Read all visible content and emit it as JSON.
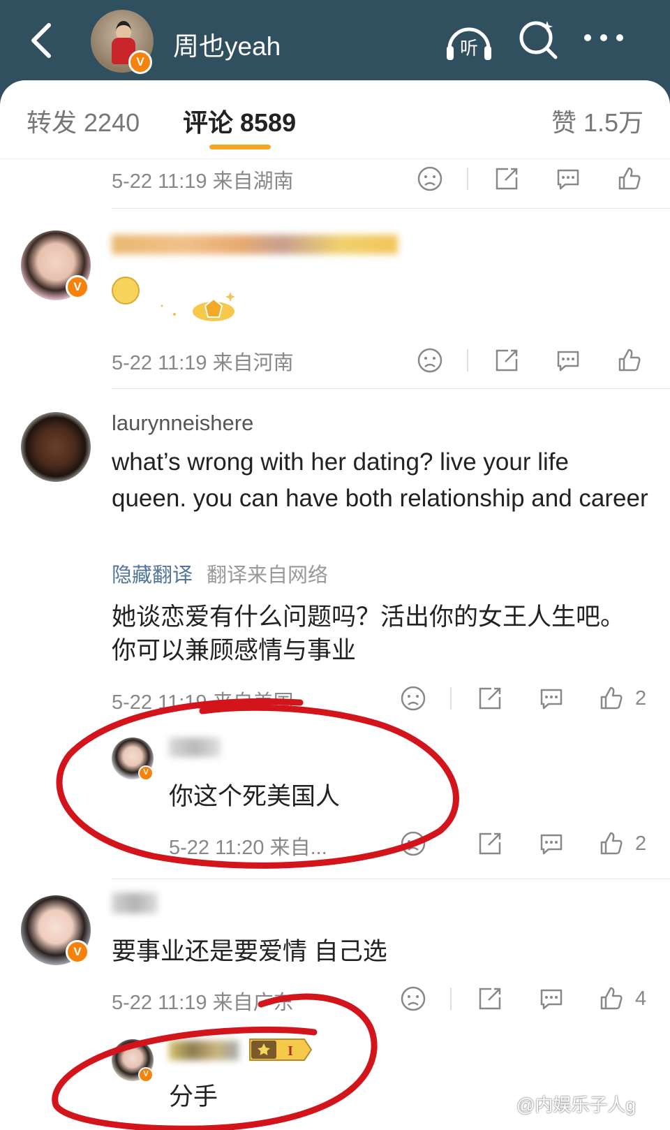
{
  "header": {
    "title": "周也yeah",
    "listen_label": "听",
    "verified_badge": "V"
  },
  "tabs": [
    {
      "label": "转发 2240"
    },
    {
      "label": "评论 8589"
    },
    {
      "label": "赞 1.5万"
    }
  ],
  "comments": [
    {
      "meta": "5-22 11:19 来自湖南"
    },
    {
      "meta": "5-22 11:19 来自河南"
    },
    {
      "username": "laurynneishere",
      "text": "what’s wrong with her dating? live your life queen. you can have both relationship and career",
      "hide_translation": "隐藏翻译",
      "translation_source": "翻译来自网络",
      "translation": "她谈恋爱有什么问题吗？活出你的女王人生吧。你可以兼顾感情与事业",
      "meta": "5-22 11:19 来自美国",
      "likes": "2",
      "reply": {
        "text": "你这个死美国人",
        "meta": "5-22 11:20 来自...",
        "likes": "2"
      }
    },
    {
      "text": "要事业还是要爱情 自己选",
      "meta": "5-22 11:19 来自广东",
      "likes": "4",
      "reply": {
        "text": "分手",
        "level_badge": "I"
      }
    }
  ],
  "watermark": "@内娱乐子人g",
  "colors": {
    "header_bg": "#30505f",
    "accent": "#f5a623",
    "badge": "#f6820c",
    "link": "#51759a",
    "annotation": "#d4141b"
  }
}
